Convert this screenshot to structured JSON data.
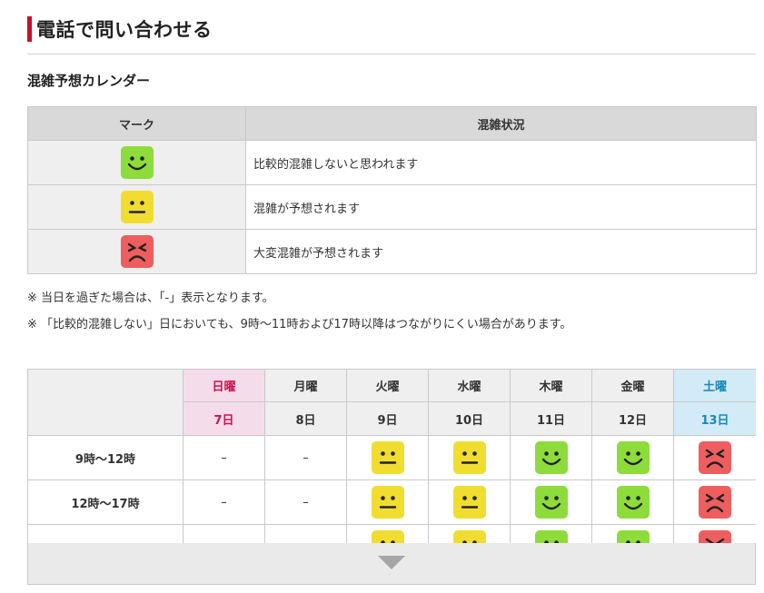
{
  "page": {
    "title": "電話で問い合わせる",
    "subtitle": "混雑予想カレンダー"
  },
  "legend": {
    "headers": [
      "マーク",
      "混雑状況"
    ],
    "rows": [
      {
        "icon": "smile-face-icon",
        "color": "#8ddc3c",
        "label": "比較的混雑しないと思われます"
      },
      {
        "icon": "neutral-face-icon",
        "color": "#f1dd2f",
        "label": "混雑が予想されます"
      },
      {
        "icon": "angry-face-icon",
        "color": "#ee5e5e",
        "label": "大変混雑が予想されます"
      }
    ]
  },
  "notes": [
    "※ 当日を過ぎた場合は、「-」表示となります。",
    "※ 「比較的混雑しない」日においても、9時～11時および17時以降はつながりにくい場合があります。"
  ],
  "calendar": {
    "days": [
      {
        "dow": "日曜",
        "date": "7日",
        "kind": "sun"
      },
      {
        "dow": "月曜",
        "date": "8日",
        "kind": "weekday"
      },
      {
        "dow": "火曜",
        "date": "9日",
        "kind": "weekday"
      },
      {
        "dow": "水曜",
        "date": "10日",
        "kind": "weekday"
      },
      {
        "dow": "木曜",
        "date": "11日",
        "kind": "weekday"
      },
      {
        "dow": "金曜",
        "date": "12日",
        "kind": "weekday"
      },
      {
        "dow": "土曜",
        "date": "13日",
        "kind": "sat"
      }
    ],
    "rows": [
      {
        "time": "9時～12時",
        "status": [
          "-",
          "-",
          "neutral",
          "neutral",
          "smile",
          "smile",
          "angry"
        ]
      },
      {
        "time": "12時～17時",
        "status": [
          "-",
          "-",
          "neutral",
          "neutral",
          "smile",
          "smile",
          "angry"
        ]
      },
      {
        "time": "",
        "status": [
          "",
          "",
          "neutral",
          "neutral",
          "smile",
          "smile",
          "angry"
        ]
      }
    ],
    "dash_symbol": "–"
  },
  "colors": {
    "accent": "#c8102e",
    "sunday_bg": "#f5dcea",
    "sunday_text": "#d0104c",
    "saturday_bg": "#d3ebf7",
    "saturday_text": "#1987b8"
  },
  "expand": {
    "icon": "chevron-down-icon"
  }
}
